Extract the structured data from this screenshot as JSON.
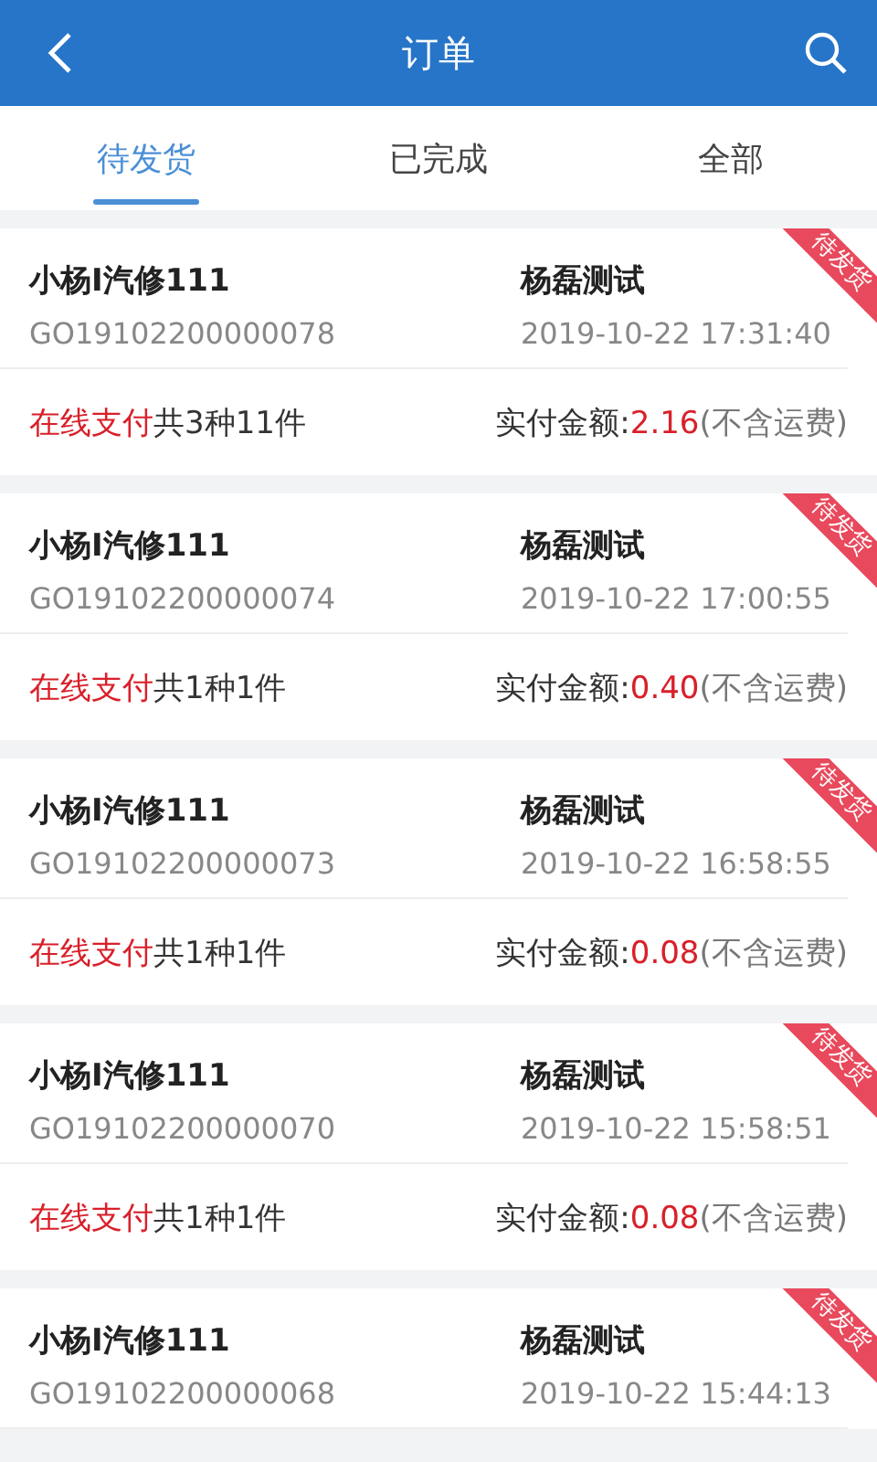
{
  "header": {
    "title": "订单"
  },
  "tabs": [
    {
      "label": "待发货",
      "selected": true
    },
    {
      "label": "已完成",
      "selected": false
    },
    {
      "label": "全部",
      "selected": false
    }
  ],
  "orders": [
    {
      "shop": "小杨I汽修111",
      "customer": "杨磊测试",
      "order_no": "GO19102200000078",
      "time": "2019-10-22 17:31:40",
      "badge": "待发货",
      "payment": "在线支付",
      "count": "共3种11件",
      "amount_label": "实付金额:",
      "amount": "2.16",
      "note": "(不含运费)"
    },
    {
      "shop": "小杨I汽修111",
      "customer": "杨磊测试",
      "order_no": "GO19102200000074",
      "time": "2019-10-22 17:00:55",
      "badge": "待发货",
      "payment": "在线支付",
      "count": "共1种1件",
      "amount_label": "实付金额:",
      "amount": "0.40",
      "note": "(不含运费)"
    },
    {
      "shop": "小杨I汽修111",
      "customer": "杨磊测试",
      "order_no": "GO19102200000073",
      "time": "2019-10-22 16:58:55",
      "badge": "待发货",
      "payment": "在线支付",
      "count": "共1种1件",
      "amount_label": "实付金额:",
      "amount": "0.08",
      "note": "(不含运费)"
    },
    {
      "shop": "小杨I汽修111",
      "customer": "杨磊测试",
      "order_no": "GO19102200000070",
      "time": "2019-10-22 15:58:51",
      "badge": "待发货",
      "payment": "在线支付",
      "count": "共1种1件",
      "amount_label": "实付金额:",
      "amount": "0.08",
      "note": "(不含运费)"
    },
    {
      "shop": "小杨I汽修111",
      "customer": "杨磊测试",
      "order_no": "GO19102200000068",
      "time": "2019-10-22 15:44:13",
      "badge": "待发货"
    }
  ]
}
